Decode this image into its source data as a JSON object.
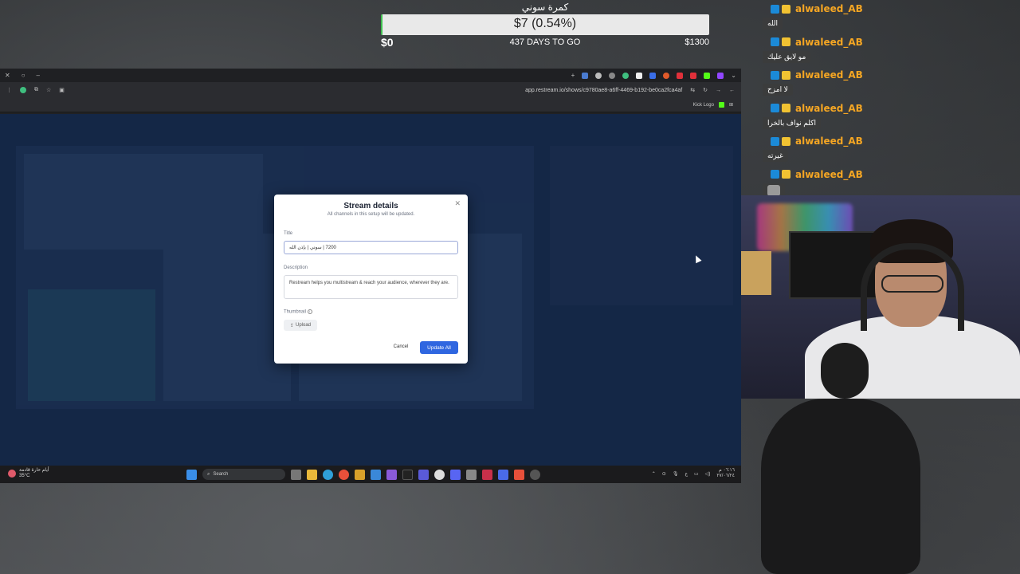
{
  "goal": {
    "title": "كمرة سوني",
    "amount": "$7 (0.54%)",
    "percent": 0.54,
    "min": "$0",
    "days_left": "437 DAYS TO GO",
    "max": "$1300"
  },
  "browser": {
    "url": "app.restream.io/shows/c9780ae8-a6ff-4469-b192-be0ca2fca4af",
    "bookmark": "Kick Logo"
  },
  "modal": {
    "title": "Stream details",
    "subtitle": "All channels in this setup will be updated.",
    "title_label": "Title",
    "title_value": "7200 | سوني | بإذن الله",
    "description_label": "Description",
    "description_value": "Restream helps you multistream & reach your audience, wherever they are.",
    "thumbnail_label": "Thumbnail",
    "upload_label": "Upload",
    "cancel_label": "Cancel",
    "update_label": "Update All",
    "close_symbol": "✕"
  },
  "taskbar": {
    "weather_line1": "أيام حارة قادمة",
    "weather_line2": "35°C",
    "search_label": "Search",
    "time": "٠٦:١٦ م",
    "date": "٢٧/٠٦/٢٤",
    "lang": "ع"
  },
  "chat": {
    "messages": [
      {
        "user": "alwaleed_AB",
        "text": "الله"
      },
      {
        "user": "alwaleed_AB",
        "text": "مو لايق عليك"
      },
      {
        "user": "alwaleed_AB",
        "text": "لا امزح"
      },
      {
        "user": "alwaleed_AB",
        "text": "اكلم نواف بالخرا"
      },
      {
        "user": "alwaleed_AB",
        "text": "غيرته"
      },
      {
        "user": "alwaleed_AB",
        "text": ""
      }
    ]
  },
  "colors": {
    "accent": "#2f66e0",
    "chat_username": "#f5a623",
    "goal_fill": "#3fbf4f"
  }
}
